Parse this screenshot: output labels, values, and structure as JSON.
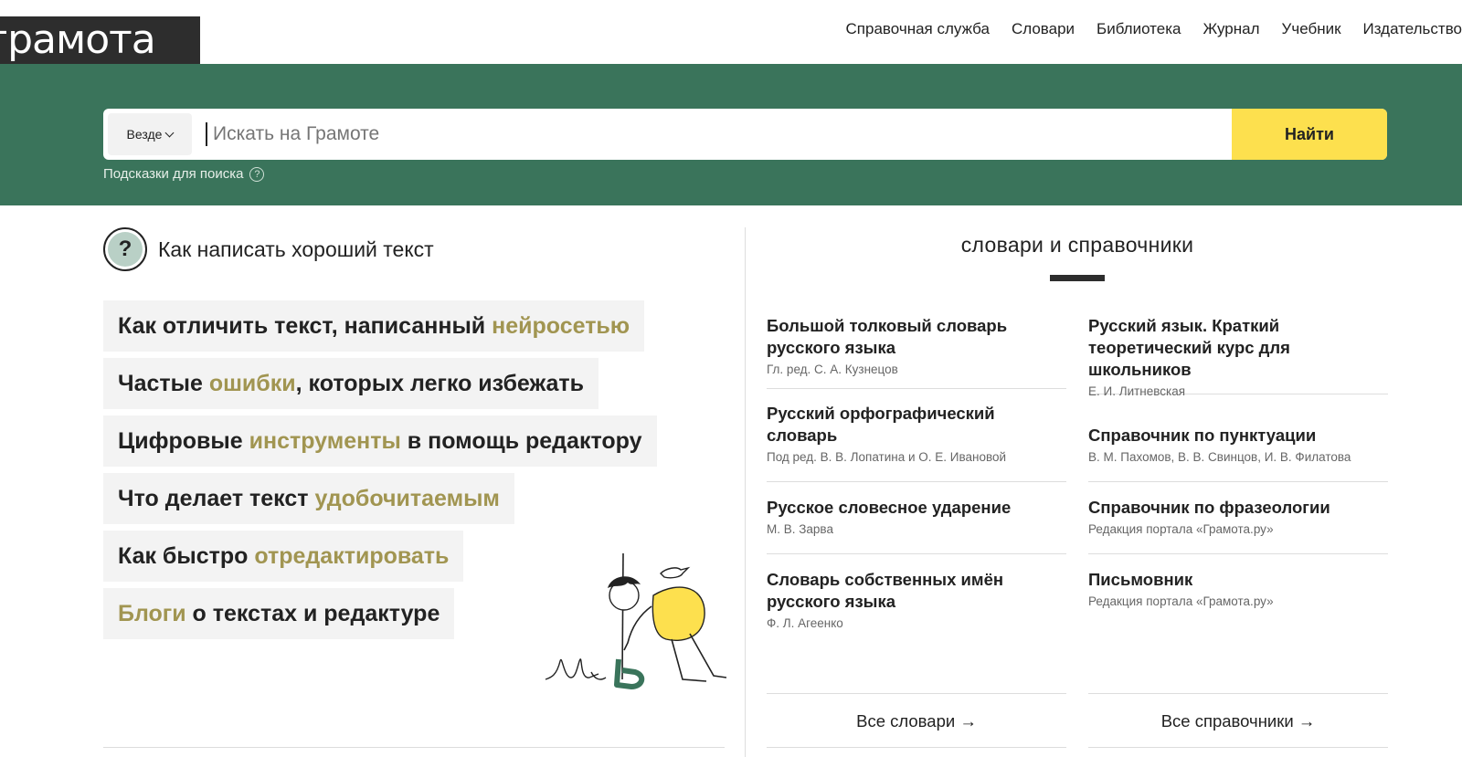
{
  "header": {
    "logo_text": "грамота",
    "nav": [
      "Справочная служба",
      "Словари",
      "Библиотека",
      "Журнал",
      "Учебник",
      "Издательство"
    ]
  },
  "search": {
    "scope": "Везде",
    "placeholder": "Искать на Грамоте",
    "value": "",
    "button": "Найти",
    "hints": "Подсказки для поиска"
  },
  "writing": {
    "title": "Как написать хороший текст",
    "articles": [
      {
        "before": "Как отличить текст, написанный ",
        "highlight": "нейросетью",
        "after": ""
      },
      {
        "before": "Частые ",
        "highlight": "ошибки",
        "after": ", которых легко избежать"
      },
      {
        "before": "Цифровые ",
        "highlight": "инструменты",
        "after": " в помощь редактору"
      },
      {
        "before": "Что делает текст ",
        "highlight": "удобочитаемым",
        "after": ""
      },
      {
        "before": "Как быстро ",
        "highlight": "отредактировать",
        "after": ""
      },
      {
        "before": "",
        "highlight": "Блоги",
        "after": " о текстах и редактуре"
      }
    ]
  },
  "dictionaries": {
    "title": "словари и справочники",
    "col1": [
      {
        "name": "Большой толковый словарь русского языка",
        "author": "Гл. ред. С. А. Кузнецов"
      },
      {
        "name": "Русский орфографический словарь",
        "author": "Под ред. В. В. Лопатина и О. Е. Ивановой"
      },
      {
        "name": "Русское словесное ударение",
        "author": "М. В. Зарва"
      },
      {
        "name": "Словарь собственных имён русского языка",
        "author": "Ф. Л. Агеенко"
      }
    ],
    "col2": [
      {
        "name": "Русский язык. Краткий теоретический курс для школьников",
        "author": "Е. И. Литневская"
      },
      {
        "name": "Справочник по пунктуации",
        "author": "В. М. Пахомов, В. В. Свинцов, И. В. Филатова"
      },
      {
        "name": "Справочник по фразеологии",
        "author": "Редакция портала «Грамота.ру»"
      },
      {
        "name": "Письмовник",
        "author": "Редакция портала «Грамота.ру»"
      }
    ],
    "all_dicts": "Все словари →",
    "all_refs": "Все справочники →"
  },
  "colors": {
    "band": "#3a745b",
    "button": "#fde04e",
    "highlight": "#a19551"
  },
  "icons": [
    "chevron-down-icon",
    "help-icon",
    "question-icon",
    "arrow-right-icon"
  ]
}
